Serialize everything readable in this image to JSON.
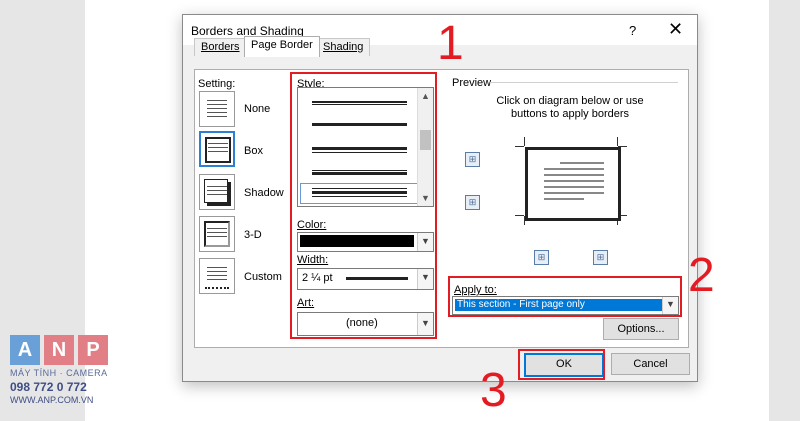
{
  "dialog": {
    "title": "Borders and Shading",
    "help": "?",
    "close": "✕"
  },
  "tabs": [
    {
      "label": "Borders"
    },
    {
      "label": "Page Border"
    },
    {
      "label": "Shading"
    }
  ],
  "setting": {
    "label": "Setting:",
    "items": [
      {
        "label": "None"
      },
      {
        "label": "Box"
      },
      {
        "label": "Shadow"
      },
      {
        "label": "3-D"
      },
      {
        "label": "Custom"
      }
    ]
  },
  "style": {
    "label": "Style:"
  },
  "color": {
    "label": "Color:",
    "value": "#000000"
  },
  "width": {
    "label": "Width:",
    "value": "2 ¼ pt"
  },
  "art": {
    "label": "Art:",
    "value": "(none)"
  },
  "preview": {
    "label": "Preview",
    "instruction": "Click on diagram below or use buttons to apply borders"
  },
  "apply_to": {
    "label": "Apply to:",
    "value": "This section - First page only"
  },
  "buttons": {
    "options": "Options...",
    "ok": "OK",
    "cancel": "Cancel"
  },
  "annotations": {
    "n1": "1",
    "n2": "2",
    "n3": "3",
    "color": "#e31b23"
  },
  "logo": {
    "letters": [
      "A",
      "N",
      "P"
    ],
    "line1": "MÁY TÍNH · CAMERA",
    "phone": "098 772 0 772",
    "url": "WWW.ANP.COM.VN"
  }
}
